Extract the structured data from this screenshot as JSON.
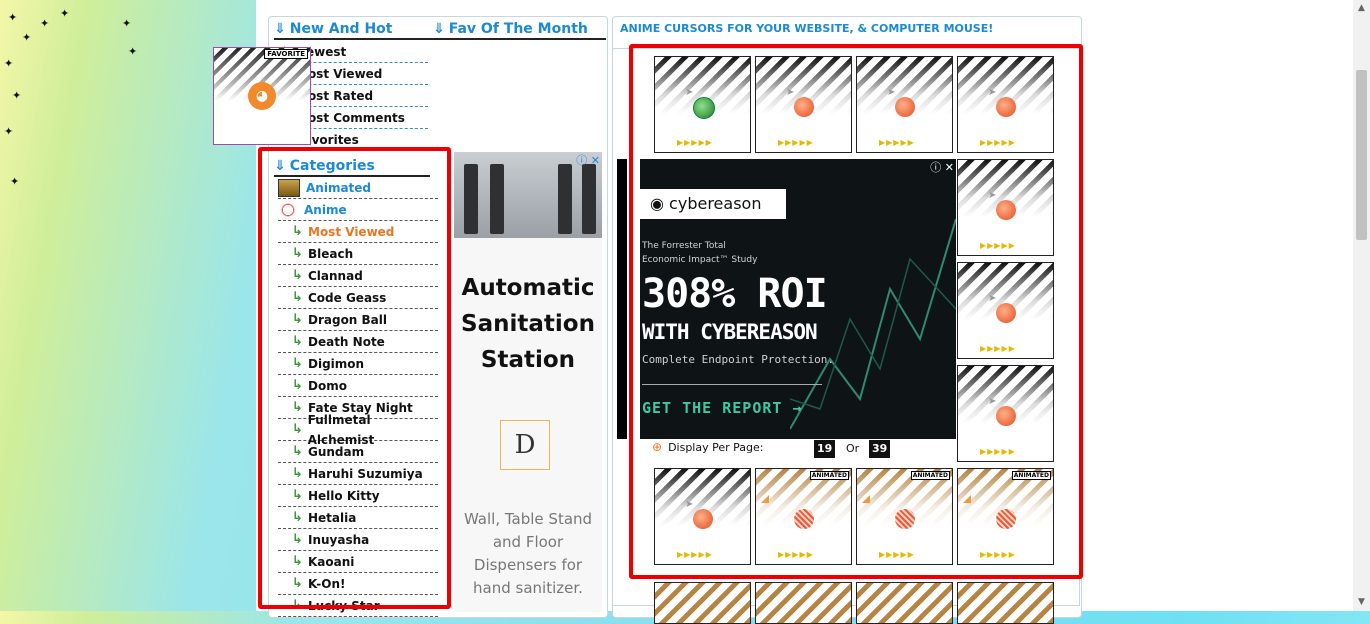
{
  "sections": {
    "new_and_hot": "New And Hot",
    "fav_month": "Fav Of The Month",
    "categories": "Categories",
    "right_title": "ANIME CURSORS FOR YOUR WEBSITE, & COMPUTER MOUSE!"
  },
  "menu": [
    {
      "label": "Newest",
      "icon": "star-icon"
    },
    {
      "label": "Most Viewed",
      "icon": "star-icon"
    },
    {
      "label": "Most Rated",
      "icon": "star-icon"
    },
    {
      "label": "Most Comments",
      "icon": "star-icon"
    },
    {
      "label": "Favorites",
      "icon": "pink-star-icon"
    }
  ],
  "fav_tag": "FAVORITE",
  "categories": {
    "top": [
      "Animated",
      "Anime"
    ],
    "active": "Most Viewed",
    "sub": [
      "Bleach",
      "Clannad",
      "Code Geass",
      "Dragon Ball",
      "Death Note",
      "Digimon",
      "Domo",
      "Fate Stay Night",
      "Fullmetal Alchemist",
      "Gundam",
      "Haruhi Suzumiya",
      "Hello Kitty",
      "Hetalia",
      "Inuyasha",
      "Kaoani",
      "K-On!",
      "Lucky Star"
    ]
  },
  "side_ad": {
    "title": "Automatic Sanitation Station",
    "logo_letter": "D",
    "desc": "Wall, Table Stand and Floor Dispensers for hand sanitizer."
  },
  "main_ad": {
    "brand": "cybereason",
    "line1": "The Forrester Total",
    "line2": "Economic Impact™ Study",
    "big": "308% ROI",
    "with": "WITH CYBEREASON",
    "comp": "Complete Endpoint Protection.",
    "cta": "GET THE REPORT →"
  },
  "display": {
    "label": "Display Per Page:",
    "opt1": "19",
    "or": "Or",
    "opt2": "39"
  },
  "tile_tag": "ANIMATED",
  "colors": {
    "accent": "#1a8ad4",
    "highlight": "#ee0000",
    "active": "#e87722"
  }
}
